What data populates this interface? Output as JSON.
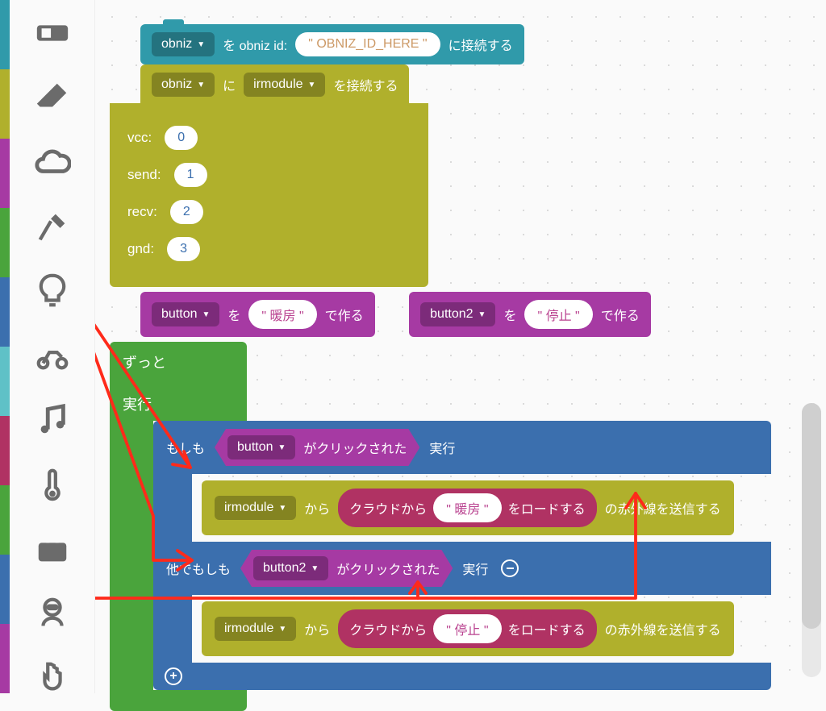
{
  "palette_colors": [
    "#309aaa",
    "#b0b02c",
    "#a63aa3",
    "#4aa43c",
    "#3b6fae",
    "#5fc1c7",
    "#b03263",
    "#4aa43c",
    "#3b6fae",
    "#a63aa3"
  ],
  "toolbox": [
    {
      "name": "device-icon"
    },
    {
      "name": "eraser-icon"
    },
    {
      "name": "cloud-icon"
    },
    {
      "name": "hammer-icon"
    },
    {
      "name": "bulb-icon"
    },
    {
      "name": "motorcycle-icon"
    },
    {
      "name": "music-icon"
    },
    {
      "name": "thermometer-icon"
    },
    {
      "name": "briefcase-icon"
    },
    {
      "name": "astronaut-icon"
    },
    {
      "name": "pointer-icon"
    }
  ],
  "blocks": {
    "connect": {
      "dd": "obniz",
      "t1": "を obniz id:",
      "val": "\" OBNIZ_ID_HERE \"",
      "t2": "に接続する"
    },
    "attach": {
      "dd": "obniz",
      "t1": "に",
      "dd2": "irmodule",
      "t2": "を接続する",
      "pins": [
        {
          "label": "vcc:",
          "v": "0"
        },
        {
          "label": "send:",
          "v": "1"
        },
        {
          "label": "recv:",
          "v": "2"
        },
        {
          "label": "gnd:",
          "v": "3"
        }
      ]
    },
    "btn1": {
      "dd": "button",
      "t1": "を",
      "val": "\" 暖房 \"",
      "t2": "で作る"
    },
    "btn2": {
      "dd": "button2",
      "t1": "を",
      "val": "\" 停止 \"",
      "t2": "で作る"
    },
    "forever": {
      "l1": "ずっと",
      "l2": "実行"
    },
    "if": {
      "pre": "もしも",
      "cond_dd": "button",
      "cond_txt": "がクリックされた",
      "run": "実行",
      "ir": {
        "dd": "irmodule",
        "t1": "から",
        "inner_pre": "クラウドから",
        "pill": "\" 暖房 \"",
        "inner_post": "をロードする",
        "tail": "の赤外線を送信する"
      }
    },
    "elseif": {
      "pre": "他でもしも",
      "cond_dd": "button2",
      "cond_txt": "がクリックされた",
      "run": "実行",
      "ir": {
        "dd": "irmodule",
        "t1": "から",
        "inner_pre": "クラウドから",
        "pill": "\" 停止 \"",
        "inner_post": "をロードする",
        "tail": "の赤外線を送信する"
      }
    }
  }
}
